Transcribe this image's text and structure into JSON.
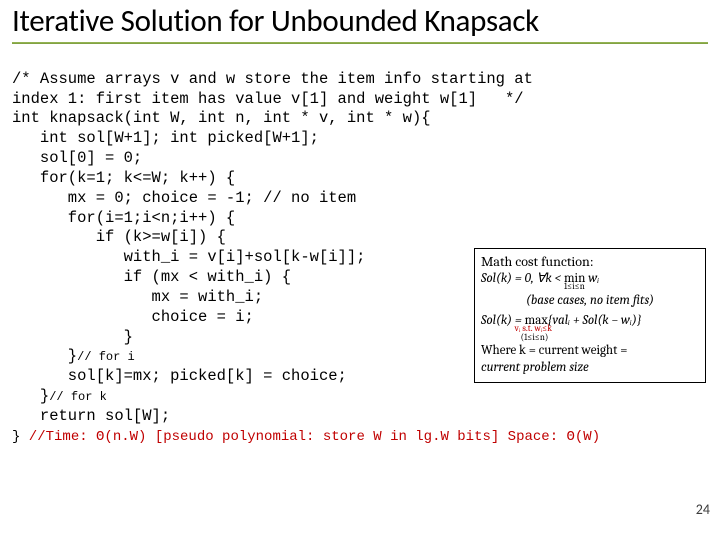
{
  "title": "Iterative Solution for Unbounded Knapsack",
  "code": {
    "c1": "/* Assume arrays v and w store the item info starting at",
    "c2": "index 1: first item has value v[1] and weight w[1]   */",
    "c3": "int knapsack(int W, int n, int * v, int * w){",
    "c4": "   int sol[W+1]; int picked[W+1];",
    "c5": "   sol[0] = 0;",
    "c6": "   for(k=1; k<=W; k++) {",
    "c7": "      mx = 0; choice = -1; // no item",
    "c8": "      for(i=1;i<n;i++) {",
    "c9": "         if (k>=w[i]) {",
    "c10": "            with_i = v[i]+sol[k-w[i]];",
    "c11": "            if (mx < with_i) {",
    "c12": "               mx = with_i;",
    "c13": "               choice = i;",
    "c14": "            }",
    "c15": "      }",
    "c15b": "// for i",
    "c16": "      sol[k]=mx; picked[k] = choice;",
    "c17": "   }",
    "c17b": "// for k",
    "c18": "   return sol[W];",
    "c19a": "}",
    "c19b": " //Time: Θ(n.W) [pseudo polynomial: store W in lg.W bits] Space: Θ(W)"
  },
  "math": {
    "hdr": "Math cost function:",
    "l1a": "Sol(k) = 0,   ∀k < ",
    "l1b": "min",
    "l1c": "1≤i≤n",
    "l1d": " wᵢ",
    "l2": "(base cases, no item fits)",
    "l3a": "Sol(k) = ",
    "l3b": "max",
    "l3sub": "vᵢ s.t. wᵢ≤k",
    "l3c": "{valᵢ + Sol(k − wᵢ)}",
    "l3sub2": "(1≤i≤n)",
    "l4": "Where k = current weight =",
    "l5": "current problem size"
  },
  "pagenum": "24"
}
